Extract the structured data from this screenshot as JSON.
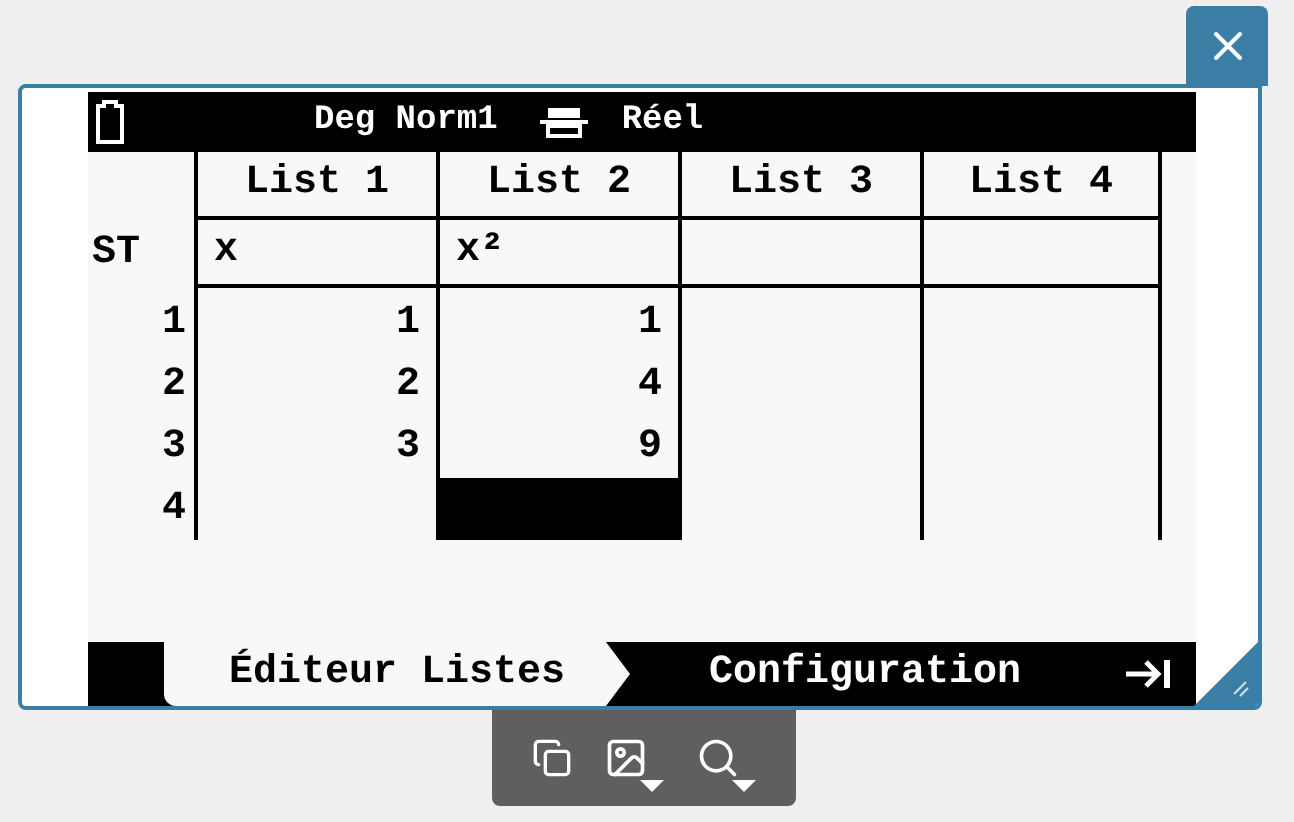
{
  "status_bar": {
    "mode": "Deg Norm1",
    "number_format": "Réel"
  },
  "table": {
    "columns": [
      "List 1",
      "List 2",
      "List 3",
      "List 4"
    ],
    "sub_row": {
      "label": "ST",
      "cells": [
        {
          "text": "x",
          "selected": false
        },
        {
          "text": "x²",
          "selected": false
        },
        {
          "selected": false
        },
        {
          "selected": false
        }
      ]
    },
    "rows": [
      {
        "label": "1",
        "cells": [
          {
            "text": "1",
            "selected": false
          },
          {
            "text": "1",
            "selected": false
          },
          {
            "selected": false
          },
          {
            "selected": false
          }
        ]
      },
      {
        "label": "2",
        "cells": [
          {
            "text": "2",
            "selected": false
          },
          {
            "text": "4",
            "selected": false
          },
          {
            "selected": false
          },
          {
            "selected": false
          }
        ]
      },
      {
        "label": "3",
        "cells": [
          {
            "text": "3",
            "selected": false
          },
          {
            "text": "9",
            "selected": false
          },
          {
            "selected": false
          },
          {
            "selected": false
          }
        ]
      },
      {
        "label": "4",
        "cells": [
          {
            "selected": false
          },
          {
            "selected": true
          },
          {
            "selected": false
          },
          {
            "selected": false
          }
        ]
      }
    ]
  },
  "tabs": [
    {
      "label": "Éditeur Listes",
      "selected": true
    },
    {
      "label": "Configuration",
      "selected": false
    }
  ]
}
